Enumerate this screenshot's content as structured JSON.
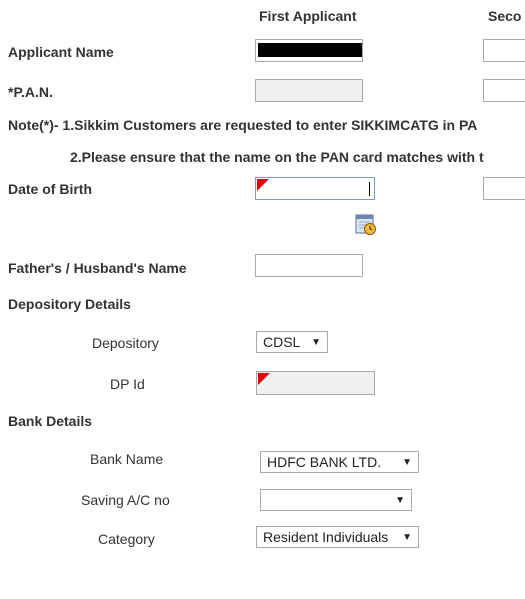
{
  "columns": {
    "first": "First Applicant",
    "second": "Seco"
  },
  "labels": {
    "applicant_name": "Applicant Name",
    "pan": "*P.A.N.",
    "note1": "Note(*)- 1.Sikkim Customers are requested to enter SIKKIMCATG in PA",
    "note2": "2.Please ensure that the name on the PAN card matches with t",
    "dob": "Date of Birth",
    "father_husband": "Father's / Husband's Name",
    "depository_details": "Depository Details",
    "depository": "Depository",
    "dp_id": "DP Id",
    "bank_details": "Bank Details",
    "bank_name": "Bank Name",
    "saving_ac": "Saving A/C no",
    "category": "Category"
  },
  "fields": {
    "depository_value": "CDSL",
    "bank_name_value": "HDFC BANK LTD.",
    "saving_ac_value": "",
    "category_value": "Resident Individuals"
  },
  "icons": {
    "calendar": "calendar-icon",
    "dropdown": "chevron-down-icon",
    "required_marker": "required-marker-icon"
  },
  "colors": {
    "required_marker": "#e00000",
    "name_redaction": "#000000"
  }
}
